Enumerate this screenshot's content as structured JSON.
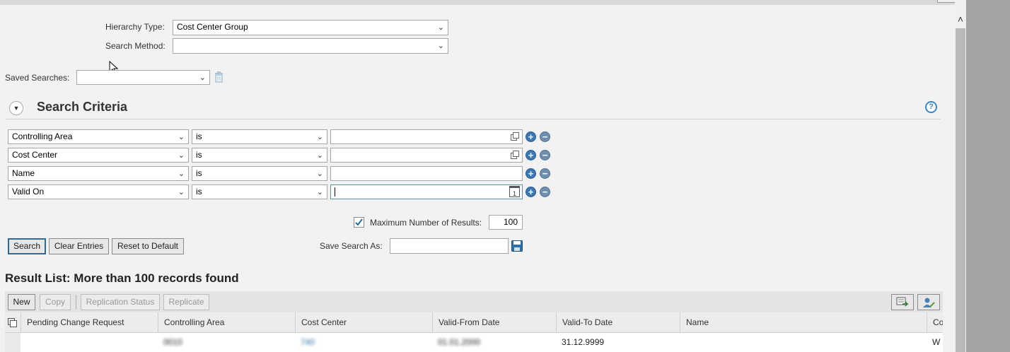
{
  "hierarchy": {
    "type_label": "Hierarchy Type:",
    "type_value": "Cost Center Group",
    "method_label": "Search Method:",
    "method_value": ""
  },
  "saved_searches": {
    "label": "Saved Searches:",
    "value": ""
  },
  "search_criteria": {
    "title": "Search Criteria",
    "rows": [
      {
        "field": "Controlling Area",
        "operator": "is",
        "value": ""
      },
      {
        "field": "Cost Center",
        "operator": "is",
        "value": ""
      },
      {
        "field": "Name",
        "operator": "is",
        "value": ""
      },
      {
        "field": "Valid On",
        "operator": "is",
        "value": ""
      }
    ],
    "max_results_label": "Maximum Number of Results:",
    "max_results_value": "100",
    "max_results_checked": true
  },
  "actions": {
    "search": "Search",
    "clear": "Clear Entries",
    "reset": "Reset to Default",
    "save_search_label": "Save Search As:",
    "save_search_value": ""
  },
  "result": {
    "title": "Result List: More than 100 records found",
    "toolbar": {
      "new": "New",
      "copy": "Copy",
      "replication_status": "Replication Status",
      "replicate": "Replicate"
    },
    "columns": [
      "Pending Change Request",
      "Controlling Area",
      "Cost Center",
      "Valid-From Date",
      "Valid-To Date",
      "Name",
      "Co"
    ],
    "rows": [
      {
        "pending": "",
        "controlling_area": "0010",
        "cost_center": "740",
        "valid_from": "01.01.2000",
        "valid_to": "31.12.9999",
        "name": "",
        "co": "W"
      }
    ]
  },
  "calendar_icon_text": "1",
  "colors": {
    "accent": "#2a6b9a",
    "plus": "#3b77b4",
    "help": "#3a86c8"
  }
}
